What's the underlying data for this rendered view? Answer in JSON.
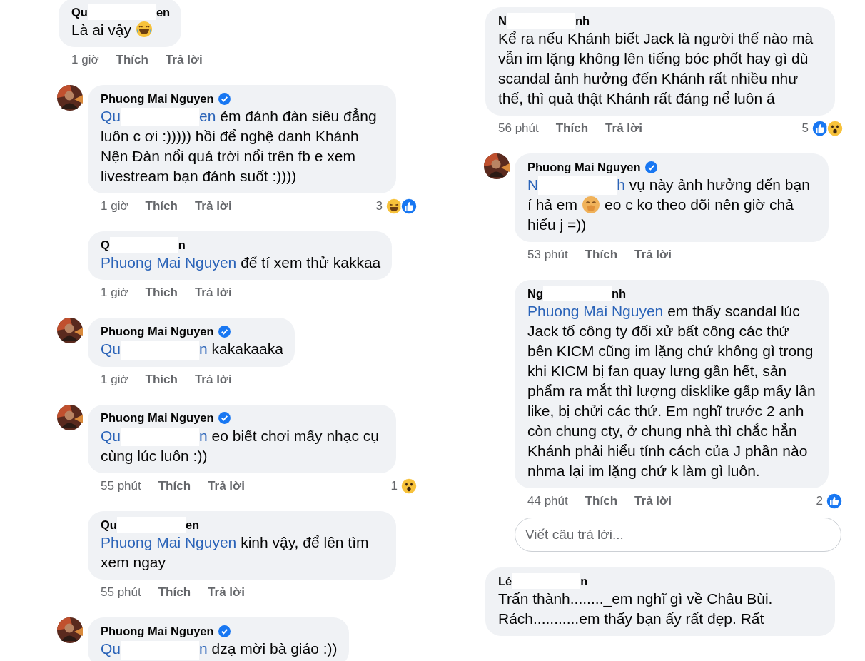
{
  "columns": [
    {
      "threads": [
        {
          "author_parts": [
            "Qu",
            "en"
          ],
          "verified": false,
          "avatar": false,
          "body": [
            {
              "kind": "text",
              "text": "Là ai vậy"
            },
            {
              "kind": "laugh_emoji"
            }
          ],
          "time": "1 giờ",
          "like": "Thích",
          "reply": "Trả lời",
          "replies": [
            {
              "author_parts": [
                "Phuong Mai Nguyen"
              ],
              "verified": true,
              "avatar": true,
              "body": [
                {
                  "kind": "mention",
                  "parts": [
                    "Qu",
                    "en"
                  ]
                },
                {
                  "kind": "text",
                  "text": " ẻm đánh đàn siêu đẳng luôn c ơi :))))) hồi để nghệ danh Khánh Nện Đàn nổi quá trời nổi trên fb e xem livestream bạn đánh suốt :))))"
                }
              ],
              "time": "1 giờ",
              "like": "Thích",
              "reply": "Trả lời",
              "reactions": {
                "count": "3",
                "icons": [
                  {
                    "kind": "haha"
                  },
                  {
                    "kind": "like"
                  }
                ]
              }
            },
            {
              "author_parts": [
                "Q",
                "n"
              ],
              "verified": false,
              "avatar": false,
              "body": [
                {
                  "kind": "mention",
                  "parts": [
                    "Phuong Mai Nguyen"
                  ]
                },
                {
                  "kind": "text",
                  "text": " để tí xem thử kakkaa"
                }
              ],
              "time": "1 giờ",
              "like": "Thích",
              "reply": "Trả lời"
            },
            {
              "author_parts": [
                "Phuong Mai Nguyen"
              ],
              "verified": true,
              "avatar": true,
              "body": [
                {
                  "kind": "mention",
                  "parts": [
                    "Qu",
                    "n"
                  ]
                },
                {
                  "kind": "text",
                  "text": " kakakaaka"
                }
              ],
              "time": "1 giờ",
              "like": "Thích",
              "reply": "Trả lời"
            },
            {
              "author_parts": [
                "Phuong Mai Nguyen"
              ],
              "verified": true,
              "avatar": true,
              "body": [
                {
                  "kind": "mention",
                  "parts": [
                    "Qu",
                    "n"
                  ]
                },
                {
                  "kind": "text",
                  "text": " eo biết chơi mấy nhạc cụ cùng lúc luôn :))"
                }
              ],
              "time": "55 phút",
              "like": "Thích",
              "reply": "Trả lời",
              "reactions": {
                "count": "1",
                "icons": [
                  {
                    "kind": "wow"
                  }
                ]
              }
            },
            {
              "author_parts": [
                "Qu",
                "en"
              ],
              "verified": false,
              "avatar": false,
              "body": [
                {
                  "kind": "mention",
                  "parts": [
                    "Phuong Mai Nguyen"
                  ]
                },
                {
                  "kind": "text",
                  "text": " kinh vậy, để lên tìm xem ngay"
                }
              ],
              "time": "55 phút",
              "like": "Thích",
              "reply": "Trả lời"
            },
            {
              "author_parts": [
                "Phuong Mai Nguyen"
              ],
              "verified": true,
              "avatar": true,
              "body": [
                {
                  "kind": "mention",
                  "parts": [
                    "Qu",
                    "n"
                  ]
                },
                {
                  "kind": "text",
                  "text": " dzạ mời bà giáo :))"
                }
              ]
            }
          ]
        }
      ]
    },
    {
      "threads": [
        {
          "author_parts": [
            "N",
            "nh"
          ],
          "verified": false,
          "avatar": false,
          "body": [
            {
              "kind": "text",
              "text": "Kể ra nếu Khánh biết Jack là người thế nào mà vẫn im lặng không lên tiếng bóc phốt hay gì dù scandal ảnh hưởng đến Khánh rất nhiều như thế, thì quả thật Khánh rất đáng nể luôn á"
            }
          ],
          "time": "56 phút",
          "like": "Thích",
          "reply": "Trả lời",
          "reactions": {
            "count": "5",
            "icons": [
              {
                "kind": "like"
              },
              {
                "kind": "wow"
              }
            ]
          },
          "replies": [
            {
              "author_parts": [
                "Phuong Mai Nguyen"
              ],
              "verified": true,
              "avatar": true,
              "body": [
                {
                  "kind": "mention",
                  "parts": [
                    "N",
                    "h"
                  ]
                },
                {
                  "kind": "text",
                  "text": " vụ này ảnh hưởng đến bạn í hả em"
                },
                {
                  "kind": "shush_emoji"
                },
                {
                  "kind": "text",
                  "text": "eo c ko theo dõi nên giờ chả hiểu j =))"
                }
              ],
              "time": "53 phút",
              "like": "Thích",
              "reply": "Trả lời"
            },
            {
              "author_parts": [
                "Ng",
                "nh"
              ],
              "verified": false,
              "avatar": false,
              "body": [
                {
                  "kind": "mention",
                  "parts": [
                    "Phuong Mai Nguyen"
                  ]
                },
                {
                  "kind": "text",
                  "text": " em thấy scandal lúc Jack tố công ty đối xử bất công các thứ bên KICM cũng im lặng chứ không gì trong khi KICM bị fan quay lưng gần hết, sản phẩm ra mắt thì lượng disklike gấp mấy lần like, bị chửi các thứ. Em nghĩ trước 2 anh còn chung cty, ở chung nhà thì chắc hẳn Khánh phải hiểu tính cách của J phần nào nhma lại im lặng chứ k làm gì luôn."
                }
              ],
              "time": "44 phút",
              "like": "Thích",
              "reply": "Trả lời",
              "reactions": {
                "count": "2",
                "icons": [
                  {
                    "kind": "like"
                  }
                ]
              }
            }
          ],
          "reply_box": {
            "placeholder": "Viết câu trả lời..."
          }
        },
        {
          "author_parts": [
            "Lé",
            "n"
          ],
          "verified": false,
          "avatar": false,
          "body": [
            {
              "kind": "text",
              "text": "Trấn thành........_em nghĩ gì về Châu Bùi. Rách...........em thấy bạn ấy rất đẹp. Rất"
            }
          ]
        }
      ]
    }
  ]
}
